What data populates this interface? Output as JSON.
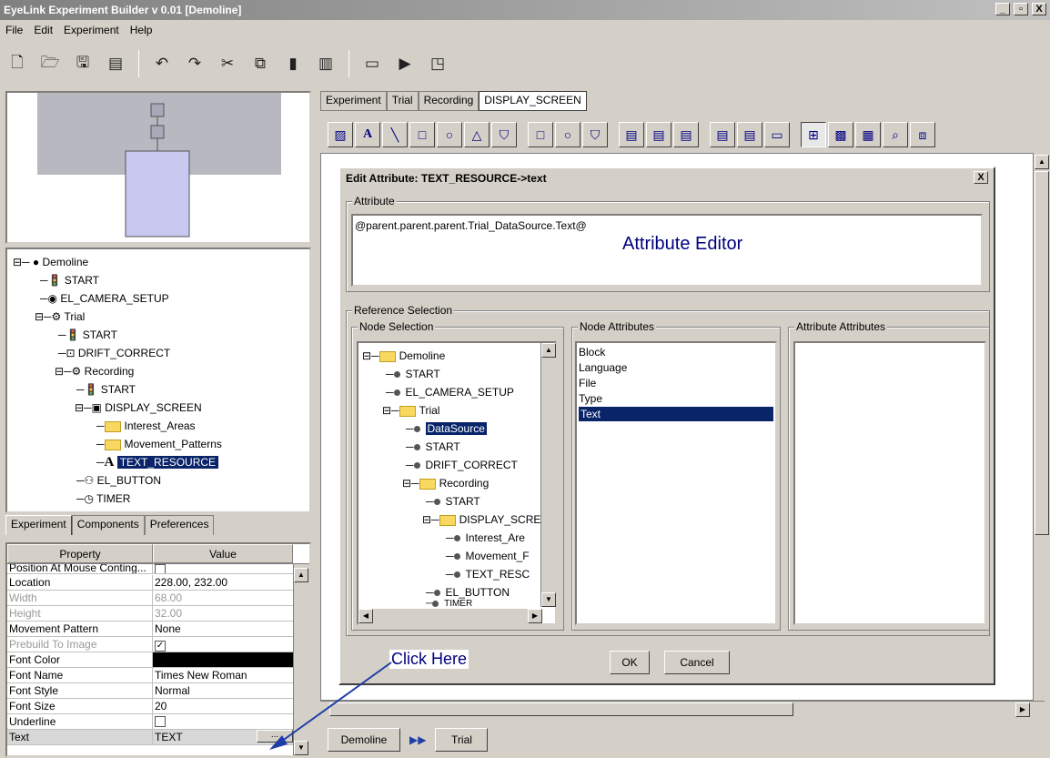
{
  "window": {
    "title": "EyeLink Experiment Builder v 0.01 [Demoline]",
    "buttons": [
      "_",
      "̵",
      "X"
    ]
  },
  "menu": [
    "File",
    "Edit",
    "Experiment",
    "Help"
  ],
  "toolbar_icons": [
    "new-icon",
    "open-icon",
    "save-icon",
    "save-all-icon",
    "undo-icon",
    "redo-icon",
    "cut-icon",
    "copy-icon",
    "paste-icon",
    "delete-icon",
    "build-icon",
    "run-icon",
    "export-icon"
  ],
  "tree": {
    "items": [
      {
        "label": "Demoline"
      },
      {
        "label": "START"
      },
      {
        "label": "EL_CAMERA_SETUP"
      },
      {
        "label": "Trial"
      },
      {
        "label": "START"
      },
      {
        "label": "DRIFT_CORRECT"
      },
      {
        "label": "Recording"
      },
      {
        "label": "START"
      },
      {
        "label": "DISPLAY_SCREEN"
      },
      {
        "label": "Interest_Areas"
      },
      {
        "label": "Movement_Patterns"
      },
      {
        "label": "TEXT_RESOURCE"
      },
      {
        "label": "EL_BUTTON"
      },
      {
        "label": "TIMER"
      }
    ]
  },
  "left_tabs": [
    "Experiment",
    "Components",
    "Preferences"
  ],
  "props": {
    "header": [
      "Property",
      "Value"
    ],
    "rows": [
      {
        "name": "Position At Mouse Conting...",
        "value": ""
      },
      {
        "name": "Location",
        "value": "228.00, 232.00"
      },
      {
        "name": "Width",
        "value": "68.00"
      },
      {
        "name": "Height",
        "value": "32.00"
      },
      {
        "name": "Movement Pattern",
        "value": "None"
      },
      {
        "name": "Prebuild To Image",
        "value": "✓"
      },
      {
        "name": "Font Color",
        "value": ""
      },
      {
        "name": "Font Name",
        "value": "Times New Roman"
      },
      {
        "name": "Font Style",
        "value": "Normal"
      },
      {
        "name": "Font Size",
        "value": "20"
      },
      {
        "name": "Underline",
        "value": ""
      },
      {
        "name": "Text",
        "value": "TEXT"
      }
    ],
    "ellipsis": "..."
  },
  "right_tabs": [
    "Experiment",
    "Trial",
    "Recording",
    "DISPLAY_SCREEN"
  ],
  "dialog": {
    "title": "Edit Attribute: TEXT_RESOURCE->text",
    "attribute_label": "Attribute",
    "attribute_value": "@parent.parent.parent.Trial_DataSource.Text@",
    "editor_caption": "Attribute Editor",
    "ref_label": "Reference Selection",
    "node_sel_label": "Node Selection",
    "node_attr_label": "Node Attributes",
    "attr_attr_label": "Attribute Attributes",
    "nodes": [
      "Demoline",
      "START",
      "EL_CAMERA_SETUP",
      "Trial",
      "DataSource",
      "START",
      "DRIFT_CORRECT",
      "Recording",
      "START",
      "DISPLAY_SCRE",
      "Interest_Are",
      "Movement_F",
      "TEXT_RESC",
      "EL_BUTTON",
      "TIMER"
    ],
    "node_attributes": [
      "Block",
      "Language",
      "File",
      "Type",
      "Text"
    ],
    "ok": "OK",
    "cancel": "Cancel"
  },
  "callout": "Click Here",
  "breadcrumb": [
    "Demoline",
    "Trial"
  ],
  "colors": {
    "selection": "#0a246a",
    "arrow": "#1f3fa8"
  }
}
